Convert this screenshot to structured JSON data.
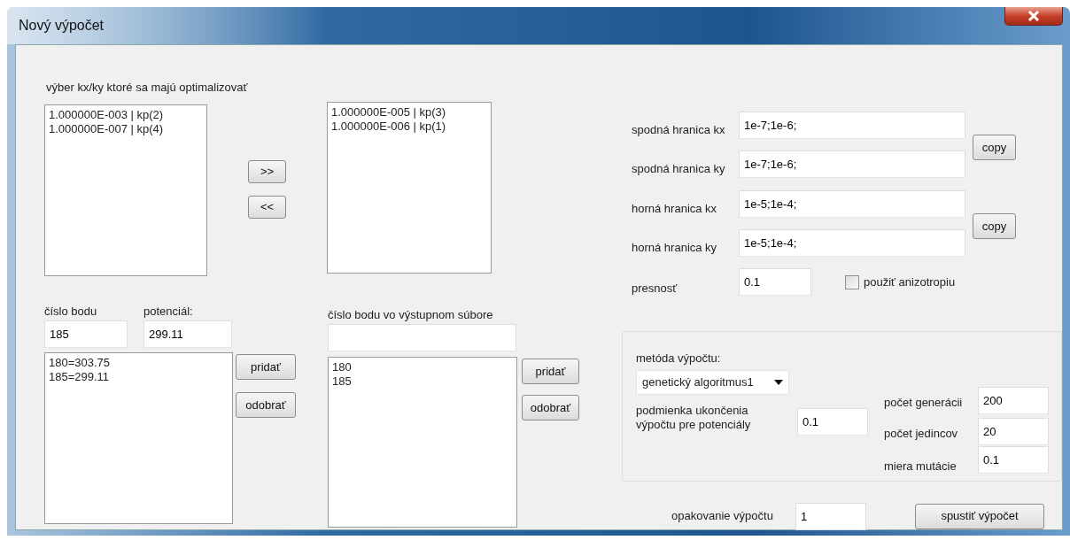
{
  "window": {
    "title": "Nový výpočet"
  },
  "optimize": {
    "label": "výber kx/ky ktoré sa majú optimalizovať",
    "available": [
      "1.000000E-003 | kp(2)",
      "1.000000E-007 | kp(4)"
    ],
    "chosen": [
      "1.000000E-005 | kp(3)",
      "1.000000E-006 | kp(1)"
    ],
    "move_right": ">>",
    "move_left": "<<"
  },
  "bound_pairs": [
    {
      "rows": [
        {
          "label": "spodná hranica kx",
          "value": "1e-7;1e-6;"
        },
        {
          "label": "spodná hranica ky",
          "value": "1e-7;1e-6;"
        }
      ],
      "button": "copy"
    },
    {
      "rows": [
        {
          "label": "horná hranica kx",
          "value": "1e-5;1e-4;"
        },
        {
          "label": "horná hranica ky",
          "value": "1e-5;1e-4;"
        }
      ],
      "button": "copy"
    }
  ],
  "precision": {
    "label": "presnosť",
    "value": "0.1"
  },
  "anisotropy": {
    "label": "použiť anizotropiu",
    "checked": false
  },
  "points": {
    "number_label": "číslo bodu",
    "number_value": "185",
    "potential_label": "potenciál:",
    "potential_value": "299.11",
    "items": [
      "180=303.75",
      "185=299.11"
    ],
    "add": "pridať",
    "remove": "odobrať"
  },
  "output_points": {
    "label": "číslo bodu vo výstupnom súbore",
    "items": [
      "180",
      "185"
    ],
    "add": "pridať",
    "remove": "odobrať"
  },
  "method": {
    "label": "metóda výpočtu:",
    "value": "genetický algoritmus1",
    "stop_label": "podmienka ukončenia výpočtu pre potenciály",
    "stop_value": "0.1"
  },
  "params": [
    {
      "label": "počet generácii",
      "value": "200"
    },
    {
      "label": "počet jedincov",
      "value": "20"
    },
    {
      "label": "miera mutácie",
      "value": "0.1"
    }
  ],
  "repeat": {
    "label": "opakovanie výpočtu",
    "value": "1"
  },
  "run_button": "spustiť výpočet"
}
